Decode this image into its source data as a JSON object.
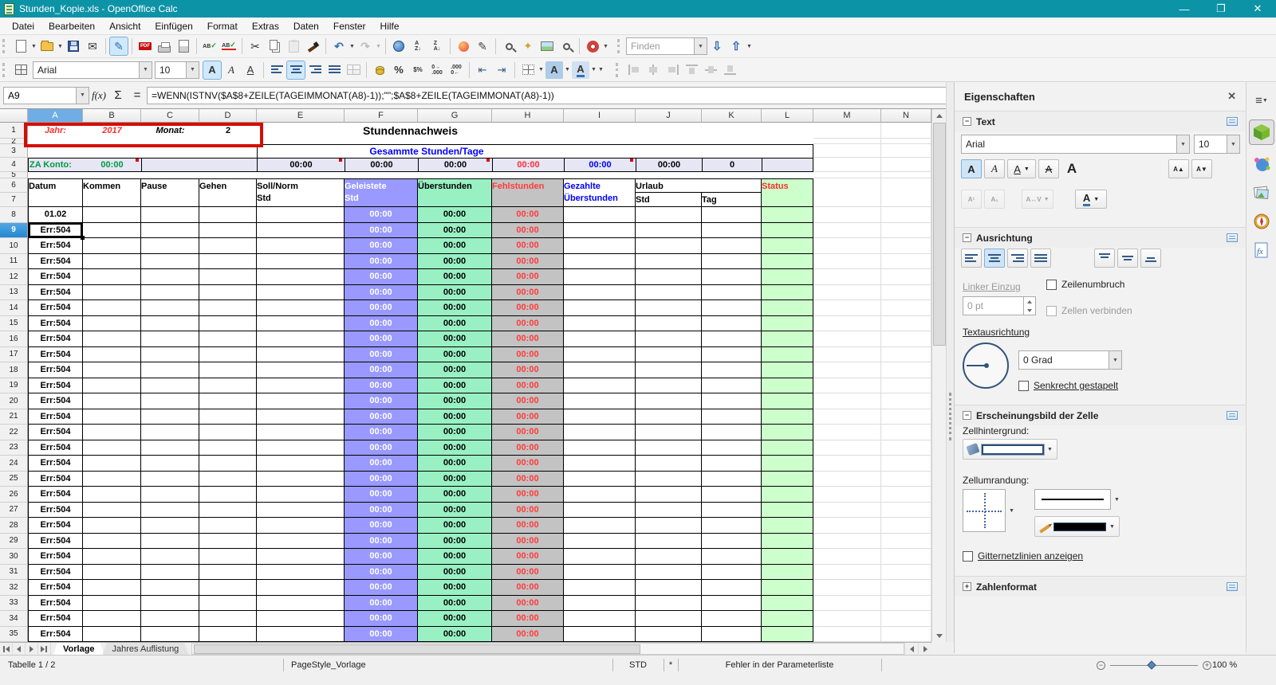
{
  "window": {
    "title": "Stunden_Kopie.xls - OpenOffice Calc",
    "controls": {
      "minimize": "—",
      "restore": "❐",
      "close": "✕"
    }
  },
  "menu": {
    "items": [
      "Datei",
      "Bearbeiten",
      "Ansicht",
      "Einfügen",
      "Format",
      "Extras",
      "Daten",
      "Fenster",
      "Hilfe"
    ]
  },
  "toolbar_find": {
    "placeholder": "Finden"
  },
  "toolbar_format": {
    "font_name": "Arial",
    "font_size": "10"
  },
  "formula_bar": {
    "cell_reference": "A9",
    "formula": "=WENN(ISTNV($A$8+ZEILE(TAGEIMMONAT(A8)-1));\"\";$A$8+ZEILE(TAGEIMMONAT(A8)-1))"
  },
  "sheet": {
    "column_letters": [
      "A",
      "B",
      "C",
      "D",
      "E",
      "F",
      "G",
      "H",
      "I",
      "J",
      "K",
      "L",
      "M",
      "N"
    ],
    "selected_column": "A",
    "selected_row": 9,
    "top_row_numbers": [
      1,
      2,
      3,
      4,
      5,
      6,
      7
    ],
    "row1": {
      "jahr_label": "Jahr:",
      "jahr_value": "2017",
      "monat_label": "Monat:",
      "monat_value": "2",
      "title": "Stundennachweis"
    },
    "row3": {
      "summary_label": "Gesammte Stunden/Tage"
    },
    "row4": {
      "za_label": "ZA Konto:",
      "za_value": "00:00",
      "e": "00:00",
      "f": "00:00",
      "g": "00:00",
      "h": "00:00",
      "i": "00:00",
      "j": "00:00",
      "k": "0"
    },
    "table_header": {
      "datum": "Datum",
      "kommen": "Kommen",
      "pause": "Pause",
      "gehen": "Gehen",
      "soll_line1": "Soll/Norm",
      "soll_line2": "Std",
      "geleistete_line1": "Geleistete",
      "geleistete_line2": "Std",
      "ueberstunden": "Überstunden",
      "fehlstunden": "Fehlstunden",
      "gezahlte_line1": "Gezahlte",
      "gezahlte_line2": "Überstunden",
      "urlaub": "Urlaub",
      "urlaub_std": "Std",
      "urlaub_tag": "Tag",
      "status": "Status"
    },
    "rows": [
      {
        "n": 8,
        "datum": "01.02",
        "f": "00:00",
        "g": "00:00",
        "h": "00:00"
      },
      {
        "n": 9,
        "datum": "Err:504",
        "f": "00:00",
        "g": "00:00",
        "h": "00:00",
        "selected": true
      },
      {
        "n": 10,
        "datum": "Err:504",
        "f": "00:00",
        "g": "00:00",
        "h": "00:00"
      },
      {
        "n": 11,
        "datum": "Err:504",
        "f": "00:00",
        "g": "00:00",
        "h": "00:00"
      },
      {
        "n": 12,
        "datum": "Err:504",
        "f": "00:00",
        "g": "00:00",
        "h": "00:00"
      },
      {
        "n": 13,
        "datum": "Err:504",
        "f": "00:00",
        "g": "00:00",
        "h": "00:00"
      },
      {
        "n": 14,
        "datum": "Err:504",
        "f": "00:00",
        "g": "00:00",
        "h": "00:00"
      },
      {
        "n": 15,
        "datum": "Err:504",
        "f": "00:00",
        "g": "00:00",
        "h": "00:00"
      },
      {
        "n": 16,
        "datum": "Err:504",
        "f": "00:00",
        "g": "00:00",
        "h": "00:00"
      },
      {
        "n": 17,
        "datum": "Err:504",
        "f": "00:00",
        "g": "00:00",
        "h": "00:00"
      },
      {
        "n": 18,
        "datum": "Err:504",
        "f": "00:00",
        "g": "00:00",
        "h": "00:00"
      },
      {
        "n": 19,
        "datum": "Err:504",
        "f": "00:00",
        "g": "00:00",
        "h": "00:00"
      },
      {
        "n": 20,
        "datum": "Err:504",
        "f": "00:00",
        "g": "00:00",
        "h": "00:00"
      },
      {
        "n": 21,
        "datum": "Err:504",
        "f": "00:00",
        "g": "00:00",
        "h": "00:00"
      },
      {
        "n": 22,
        "datum": "Err:504",
        "f": "00:00",
        "g": "00:00",
        "h": "00:00"
      },
      {
        "n": 23,
        "datum": "Err:504",
        "f": "00:00",
        "g": "00:00",
        "h": "00:00"
      },
      {
        "n": 24,
        "datum": "Err:504",
        "f": "00:00",
        "g": "00:00",
        "h": "00:00"
      },
      {
        "n": 25,
        "datum": "Err:504",
        "f": "00:00",
        "g": "00:00",
        "h": "00:00"
      },
      {
        "n": 26,
        "datum": "Err:504",
        "f": "00:00",
        "g": "00:00",
        "h": "00:00"
      },
      {
        "n": 27,
        "datum": "Err:504",
        "f": "00:00",
        "g": "00:00",
        "h": "00:00"
      },
      {
        "n": 28,
        "datum": "Err:504",
        "f": "00:00",
        "g": "00:00",
        "h": "00:00"
      },
      {
        "n": 29,
        "datum": "Err:504",
        "f": "00:00",
        "g": "00:00",
        "h": "00:00"
      },
      {
        "n": 30,
        "datum": "Err:504",
        "f": "00:00",
        "g": "00:00",
        "h": "00:00"
      },
      {
        "n": 31,
        "datum": "Err:504",
        "f": "00:00",
        "g": "00:00",
        "h": "00:00"
      },
      {
        "n": 32,
        "datum": "Err:504",
        "f": "00:00",
        "g": "00:00",
        "h": "00:00"
      },
      {
        "n": 33,
        "datum": "Err:504",
        "f": "00:00",
        "g": "00:00",
        "h": "00:00"
      },
      {
        "n": 34,
        "datum": "Err:504",
        "f": "00:00",
        "g": "00:00",
        "h": "00:00"
      },
      {
        "n": 35,
        "datum": "Err:504",
        "f": "00:00",
        "g": "00:00",
        "h": "00:00"
      }
    ],
    "colors": {
      "geleistete_bg": "#9999FF",
      "ueberstunden_bg": "#99F0C3",
      "fehlstunden_bg": "#C3C3C3",
      "status_bg": "#CCFFCC",
      "summary_row_bg": "#E6E6F5",
      "titlebar": "#0d93a6"
    }
  },
  "sheet_tabs": {
    "tabs": [
      {
        "label": "Vorlage",
        "active": true
      },
      {
        "label": "Jahres Auflistung",
        "active": false
      }
    ]
  },
  "status_bar": {
    "sheet_info": "Tabelle 1 / 2",
    "page_style": "PageStyle_Vorlage",
    "selection_mode": "STD",
    "modified_flag": "*",
    "message": "Fehler in der Parameterliste",
    "zoom_level": "100 %"
  },
  "sidebar": {
    "title": "Eigenschaften",
    "text_section": {
      "title": "Text",
      "font_name": "Arial",
      "font_size": "10"
    },
    "alignment_section": {
      "title": "Ausrichtung",
      "left_indent_label": "Linker Einzug",
      "indent_value": "0 pt",
      "wrap_label": "Zeilenumbruch",
      "merge_label": "Zellen verbinden",
      "orientation_label": "Textausrichtung",
      "degrees_value": "0 Grad",
      "stacked_label": "Senkrecht gestapelt"
    },
    "appearance_section": {
      "title": "Erscheinungsbild der Zelle",
      "background_label": "Zellhintergrund:",
      "border_label": "Zellumrandung:",
      "gridlines_label": "Gitternetzlinien anzeigen"
    },
    "number_section": {
      "title": "Zahlenformat"
    }
  }
}
